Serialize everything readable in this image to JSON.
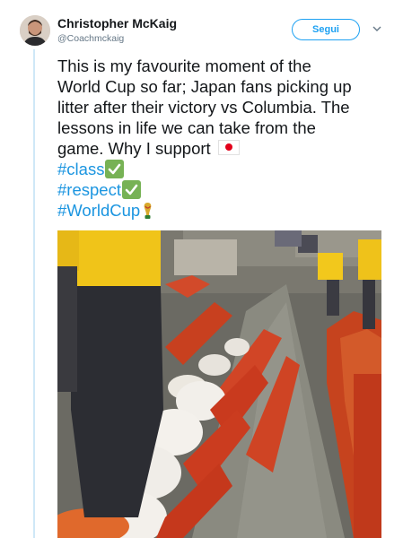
{
  "tweet": {
    "author_name": "Christopher McKaig",
    "author_handle": "@Coachmckaig",
    "follow_label": "Segui",
    "lines": [
      "This is my favourite moment of the",
      "World Cup so far; Japan fans picking up",
      "litter after their victory vs Columbia. The",
      "lessons in life we can take from the",
      "game. Why I support"
    ],
    "hashtags": [
      "#class",
      "#respect",
      "#WorldCup"
    ]
  },
  "icons": {
    "flag": "japan-flag-icon",
    "check": "check-mark-icon",
    "trophy": "world-cup-trophy-icon",
    "menu": "chevron-down-icon"
  },
  "colors": {
    "accent": "#1da1f2",
    "hashtag": "#1b95e0",
    "thread_line": "#cfe8f7",
    "check": "#77b255",
    "flag_red": "#e2001a"
  }
}
